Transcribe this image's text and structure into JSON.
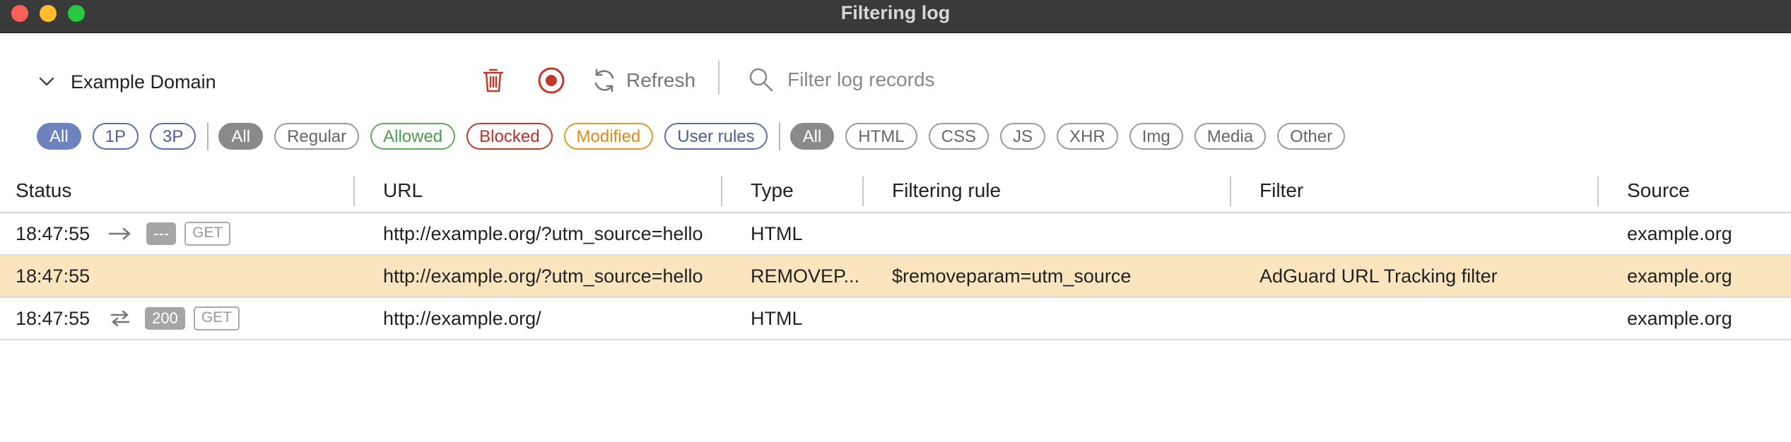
{
  "window": {
    "title": "Filtering log"
  },
  "toolbar": {
    "tab_name": "Example Domain",
    "refresh_label": "Refresh",
    "search_placeholder": "Filter log records"
  },
  "filters": {
    "party": [
      {
        "label": "All",
        "active": true
      },
      {
        "label": "1P",
        "active": false
      },
      {
        "label": "3P",
        "active": false
      }
    ],
    "event": [
      {
        "label": "All",
        "active": true
      },
      {
        "label": "Regular",
        "active": false
      },
      {
        "label": "Allowed",
        "active": false
      },
      {
        "label": "Blocked",
        "active": false
      },
      {
        "label": "Modified",
        "active": false
      },
      {
        "label": "User rules",
        "active": false
      }
    ],
    "content_type": [
      {
        "label": "All",
        "active": true
      },
      {
        "label": "HTML",
        "active": false
      },
      {
        "label": "CSS",
        "active": false
      },
      {
        "label": "JS",
        "active": false
      },
      {
        "label": "XHR",
        "active": false
      },
      {
        "label": "Img",
        "active": false
      },
      {
        "label": "Media",
        "active": false
      },
      {
        "label": "Other",
        "active": false
      }
    ]
  },
  "table": {
    "columns": {
      "status": "Status",
      "url": "URL",
      "type": "Type",
      "rule": "Filtering rule",
      "filter": "Filter",
      "source": "Source"
    },
    "rows": [
      {
        "time": "18:47:55",
        "arrow": "right-arrow-icon",
        "code": "---",
        "method": "GET",
        "url": "http://example.org/?utm_source=hello",
        "type": "HTML",
        "rule": "",
        "filter": "",
        "source": "example.org",
        "highlight": false
      },
      {
        "time": "18:47:55",
        "arrow": "",
        "code": "",
        "method": "",
        "url": "http://example.org/?utm_source=hello",
        "type": "REMOVEP...",
        "rule": "$removeparam=utm_source",
        "filter": "AdGuard URL Tracking filter",
        "source": "example.org",
        "highlight": true
      },
      {
        "time": "18:47:55",
        "arrow": "swap-arrows-icon",
        "code": "200",
        "method": "GET",
        "url": "http://example.org/",
        "type": "HTML",
        "rule": "",
        "filter": "",
        "source": "example.org",
        "highlight": false
      }
    ]
  },
  "colors": {
    "titlebar": "#3a3a3a",
    "highlight_row": "#fbe5bf",
    "blocked_red": "#c0392b",
    "allowed_green": "#5fa85c",
    "modified_orange": "#e39a2a",
    "user_rules_blue": "#4b5e9c"
  }
}
